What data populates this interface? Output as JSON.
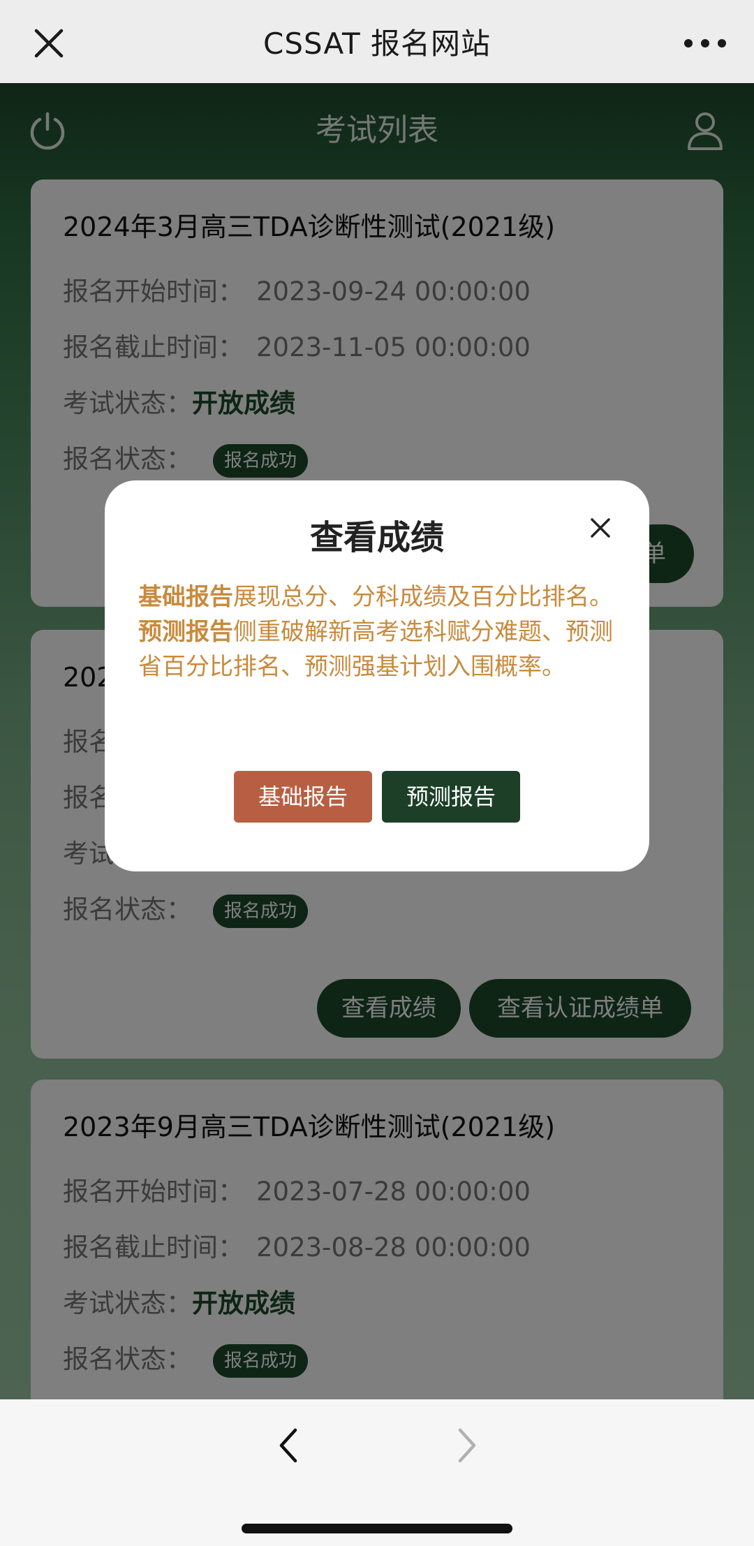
{
  "topbar": {
    "title": "CSSAT 报名网站"
  },
  "app": {
    "title": "考试列表"
  },
  "labels": {
    "start": "报名开始时间：",
    "end": "报名截止时间：",
    "exam_status": "考试状态：",
    "reg_status": "报名状态："
  },
  "exams": [
    {
      "title": "2024年3月高三TDA诊断性测试(2021级)",
      "start": "2023-09-24 00:00:00",
      "end": "2023-11-05 00:00:00",
      "exam_status": "开放成绩",
      "reg_status": "报名成功",
      "button_partial": "单"
    },
    {
      "title": "202",
      "prefix_start": "报名",
      "prefix_end": "报名",
      "prefix_exam": "考试",
      "reg_status": "报名成功",
      "btn_view": "查看成绩",
      "btn_cert": "查看认证成绩单"
    },
    {
      "title": "2023年9月高三TDA诊断性测试(2021级)",
      "start": "2023-07-28 00:00:00",
      "end": "2023-08-28 00:00:00",
      "exam_status": "开放成绩",
      "reg_status": "报名成功"
    }
  ],
  "modal": {
    "title": "查看成绩",
    "desc_b1": "基础报告",
    "desc_t1": "展现总分、分科成绩及百分比排名。",
    "desc_b2": "预测报告",
    "desc_t2": "侧重破解新高考选科赋分难题、预测省百分比排名、预测强基计划入围概率。",
    "btn_basic": "基础报告",
    "btn_predict": "预测报告"
  },
  "colors": {
    "brand_green": "#1d4a2a",
    "accent_orange": "#c88a3c",
    "btn_basic": "#b85f43"
  }
}
